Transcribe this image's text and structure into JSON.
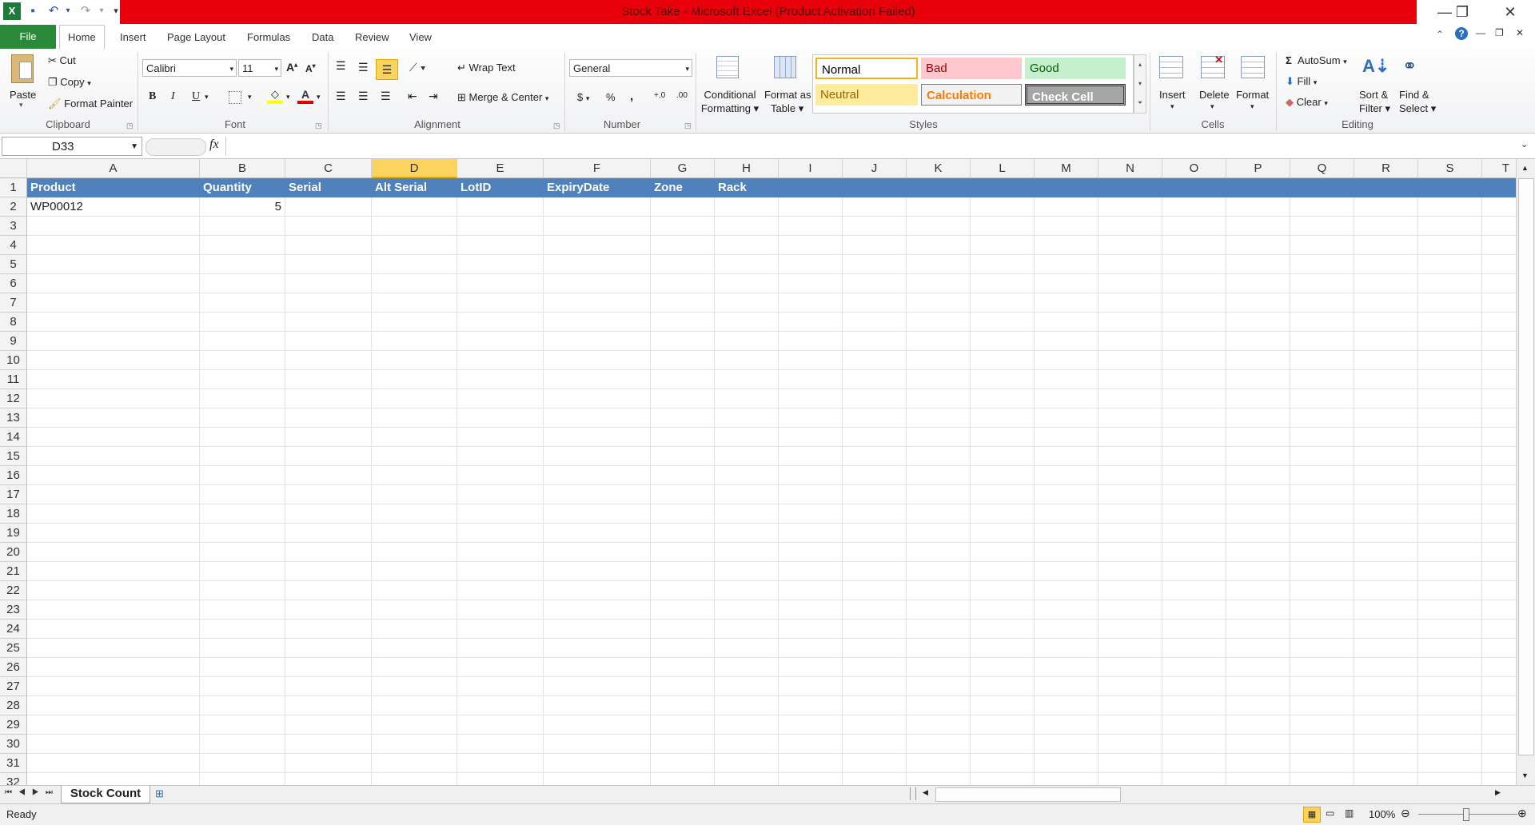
{
  "window": {
    "title": "Stock Take  -  Microsoft Excel (Product Activation Failed)",
    "minimize": "—",
    "restore": "❐",
    "close": "✕"
  },
  "qat": {
    "save_icon": "save-icon",
    "undo": "↶",
    "redo": "↷",
    "customize": "▾"
  },
  "tabs": [
    {
      "label": "File"
    },
    {
      "label": "Home"
    },
    {
      "label": "Insert"
    },
    {
      "label": "Page Layout"
    },
    {
      "label": "Formulas"
    },
    {
      "label": "Data"
    },
    {
      "label": "Review"
    },
    {
      "label": "View"
    }
  ],
  "ribbon": {
    "clipboard": {
      "paste": "Paste",
      "cut": "Cut",
      "copy": "Copy",
      "format_painter": "Format Painter",
      "group": "Clipboard"
    },
    "font": {
      "name": "Calibri",
      "size": "11",
      "group": "Font",
      "bold": "B",
      "italic": "I",
      "underline": "U"
    },
    "alignment": {
      "wrap_text": "Wrap Text",
      "merge_center": "Merge & Center",
      "group": "Alignment"
    },
    "number": {
      "format": "General",
      "currency": "$",
      "percent": "%",
      "comma": ",",
      "group": "Number"
    },
    "styles": {
      "conditional_formatting_1": "Conditional",
      "conditional_formatting_2": "Formatting",
      "format_as_table_1": "Format as",
      "format_as_table_2": "Table",
      "normal": "Normal",
      "bad": "Bad",
      "good": "Good",
      "neutral": "Neutral",
      "calculation": "Calculation",
      "check_cell": "Check Cell",
      "group": "Styles"
    },
    "cells": {
      "insert": "Insert",
      "delete": "Delete",
      "format": "Format",
      "group": "Cells"
    },
    "editing": {
      "autosum": "AutoSum",
      "fill": "Fill",
      "clear": "Clear",
      "sort_filter_1": "Sort &",
      "sort_filter_2": "Filter",
      "find_select_1": "Find &",
      "find_select_2": "Select",
      "group": "Editing"
    }
  },
  "formula_bar": {
    "name_box": "D33",
    "fx": "fx",
    "value": ""
  },
  "columns": [
    "A",
    "B",
    "C",
    "D",
    "E",
    "F",
    "G",
    "H",
    "I",
    "J",
    "K",
    "L",
    "M",
    "N",
    "O",
    "P",
    "Q",
    "R",
    "S",
    "T"
  ],
  "selected_column": "D",
  "rows": [
    "1",
    "2",
    "3",
    "4",
    "5",
    "6",
    "7",
    "8",
    "9",
    "10",
    "11",
    "12",
    "13",
    "14",
    "15",
    "16",
    "17",
    "18",
    "19",
    "20",
    "21",
    "22",
    "23",
    "24",
    "25",
    "26",
    "27",
    "28",
    "29",
    "30",
    "31",
    "32"
  ],
  "header_row": [
    "Product",
    "Quantity",
    "Serial",
    "Alt Serial",
    "LotID",
    "ExpiryDate",
    "Zone",
    "Rack"
  ],
  "data_row": {
    "product": "WP00012",
    "quantity": "5"
  },
  "sheet_tab": "Stock Count",
  "status": {
    "ready": "Ready",
    "zoom": "100%"
  }
}
